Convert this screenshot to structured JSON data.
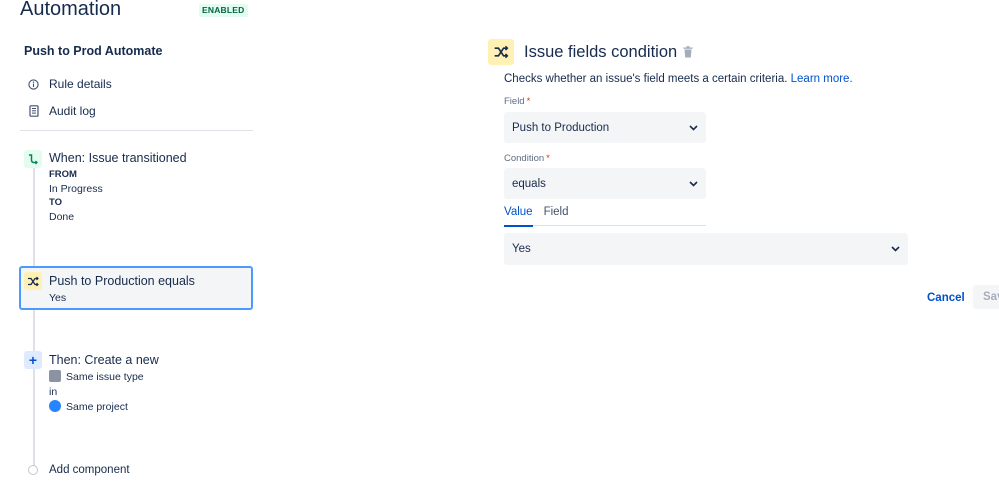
{
  "header": {
    "title": "Automation",
    "status_badge": "ENABLED"
  },
  "sidebar": {
    "rule_name": "Push to Prod Automate",
    "nav": [
      {
        "label": "Rule details",
        "icon": "info-icon"
      },
      {
        "label": "Audit log",
        "icon": "document-icon"
      }
    ],
    "trigger": {
      "title": "When: Issue transitioned",
      "from_label": "FROM",
      "from_value": "In Progress",
      "to_label": "TO",
      "to_value": "Done",
      "icon": "transition-icon"
    },
    "condition": {
      "title": "Push to Production equals",
      "value": "Yes",
      "icon": "shuffle-icon"
    },
    "action": {
      "title": "Then: Create a new",
      "issue_type": "Same issue type",
      "connector": "in",
      "project": "Same project",
      "icon": "plus-icon"
    },
    "add_component": "Add component"
  },
  "panel": {
    "title": "Issue fields condition",
    "description": "Checks whether an issue's field meets a certain criteria.",
    "learn_more": "Learn more.",
    "field": {
      "label": "Field",
      "required_mark": "*",
      "value": "Push to Production"
    },
    "condition": {
      "label": "Condition",
      "required_mark": "*",
      "value": "equals"
    },
    "tabs": [
      {
        "label": "Value",
        "active": true
      },
      {
        "label": "Field",
        "active": false
      }
    ],
    "value_select": "Yes",
    "cancel": "Cancel",
    "save": "Save"
  },
  "colors": {
    "accent": "#0052cc",
    "badge_bg": "#e3fcef",
    "badge_text": "#006644",
    "condition_bg": "#fff0b3",
    "selected_border": "#4c9aff"
  }
}
